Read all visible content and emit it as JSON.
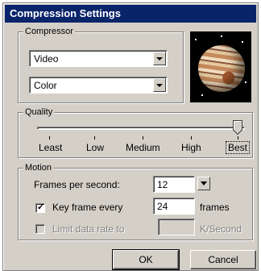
{
  "title": "Compression Settings",
  "compressor": {
    "legend": "Compressor",
    "type_value": "Video",
    "depth_value": "Color",
    "preview_icon": "jupiter-planet-image"
  },
  "quality": {
    "legend": "Quality",
    "level": "Best",
    "labels": [
      "Least",
      "Low",
      "Medium",
      "High",
      "Best"
    ]
  },
  "motion": {
    "legend": "Motion",
    "fps_label": "Frames per second:",
    "fps_value": "12",
    "keyframe_label": "Key frame every",
    "keyframe_checked": true,
    "keyframe_value": "24",
    "keyframe_unit": "frames",
    "datarate_label": "Limit data rate to",
    "datarate_checked": false,
    "datarate_value": "",
    "datarate_unit": "K/Second"
  },
  "buttons": {
    "ok": "OK",
    "cancel": "Cancel"
  }
}
